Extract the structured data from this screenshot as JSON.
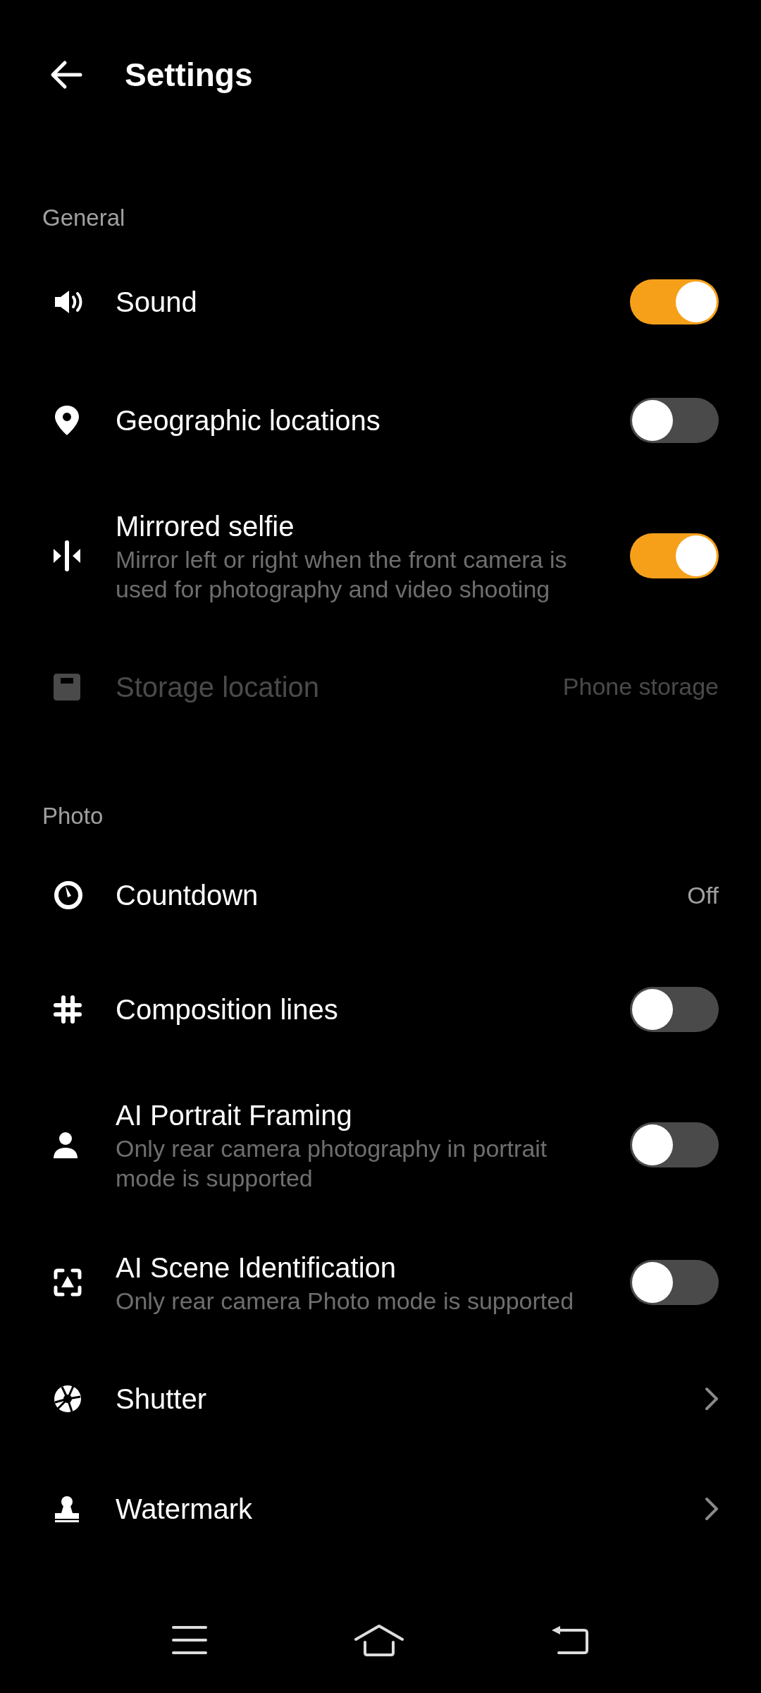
{
  "header": {
    "title": "Settings"
  },
  "sections": [
    {
      "title": "General",
      "items": [
        {
          "kind": "toggle",
          "label": "Sound",
          "on": true
        },
        {
          "kind": "toggle",
          "label": "Geographic locations",
          "on": false
        },
        {
          "kind": "toggle",
          "label": "Mirrored selfie",
          "description": "Mirror left or right when the front camera is used for photography and video shooting",
          "on": true
        },
        {
          "kind": "value",
          "label": "Storage location",
          "value": "Phone storage",
          "disabled": true
        }
      ]
    },
    {
      "title": "Photo",
      "items": [
        {
          "kind": "value",
          "label": "Countdown",
          "value": "Off",
          "disabled": false
        },
        {
          "kind": "toggle",
          "label": "Composition lines",
          "on": false
        },
        {
          "kind": "toggle",
          "label": "AI Portrait Framing",
          "description": "Only rear camera photography in portrait mode is supported",
          "on": false
        },
        {
          "kind": "toggle",
          "label": "AI Scene Identification",
          "description": "Only rear camera Photo mode is supported",
          "on": false
        },
        {
          "kind": "link",
          "label": "Shutter"
        },
        {
          "kind": "link",
          "label": "Watermark"
        }
      ]
    }
  ]
}
